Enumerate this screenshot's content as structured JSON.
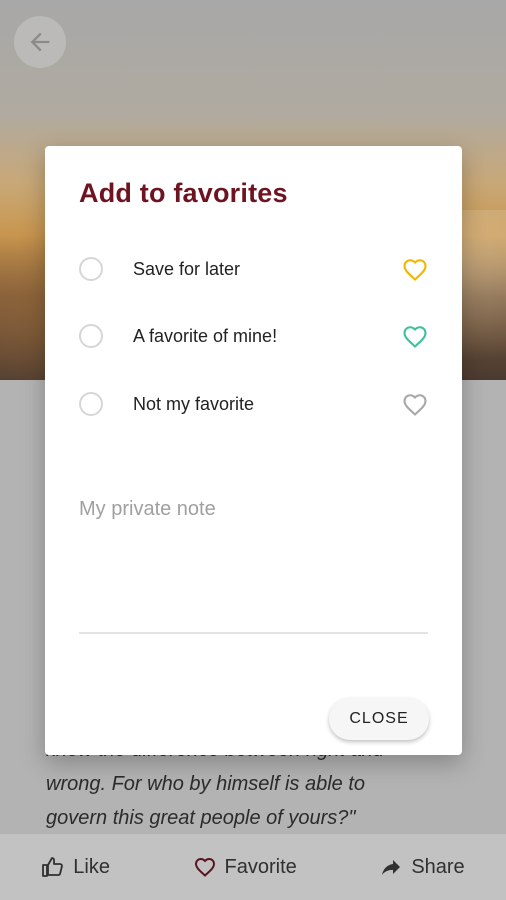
{
  "background": {
    "quote_line_1": "know the difference between right and",
    "quote_line_2": "wrong. For who by himself is able to",
    "quote_line_3": "govern this great people of yours?\"",
    "bottom_bar": {
      "like_label": "Like",
      "favorite_label": "Favorite",
      "share_label": "Share"
    }
  },
  "dialog": {
    "title": "Add to favorites",
    "options": [
      {
        "label": "Save for later",
        "heart_icon": "heart-outline-icon",
        "heart_color": "#f2b600"
      },
      {
        "label": "A favorite of mine!",
        "heart_icon": "heart-outline-icon",
        "heart_color": "#3cc19a"
      },
      {
        "label": "Not my favorite",
        "heart_icon": "heart-outline-icon",
        "heart_color": "#a8a8a8"
      }
    ],
    "note_placeholder": "My private note",
    "note_value": "",
    "close_label": "CLOSE"
  },
  "colors": {
    "title": "#6e1421",
    "radio_border": "#d6d6d6"
  }
}
